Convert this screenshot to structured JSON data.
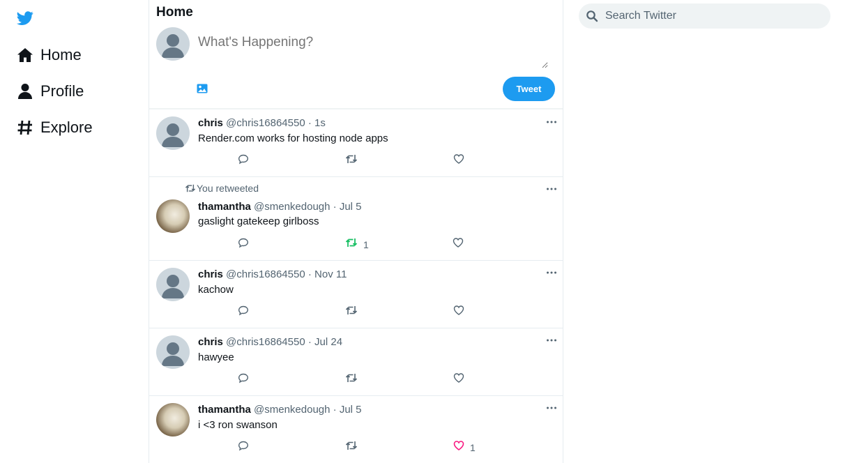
{
  "app": {
    "title": "Twitter",
    "brand_color": "#1d9bf0"
  },
  "sidebar": {
    "items": [
      {
        "label": "Home",
        "icon": "home-icon"
      },
      {
        "label": "Profile",
        "icon": "user-icon"
      },
      {
        "label": "Explore",
        "icon": "hashtag-icon"
      }
    ]
  },
  "main": {
    "title": "Home",
    "compose": {
      "placeholder": "What's Happening?",
      "tweet_button": "Tweet"
    }
  },
  "search": {
    "placeholder": "Search Twitter"
  },
  "tweets": [
    {
      "name": "chris",
      "handle": "@chris16864550",
      "time": "1s",
      "text": "Render.com works for hosting node apps",
      "retweet_count": "",
      "like_count": "",
      "retweeted_by_you": false,
      "liked": false,
      "avatar": "default-avatar"
    },
    {
      "name": "thamantha",
      "handle": "@smenkedough",
      "time": "Jul 5",
      "text": "gaslight gatekeep girlboss",
      "retweet_count": "1",
      "like_count": "",
      "retweeted_by_you": true,
      "retweet_label": "You retweeted",
      "liked": false,
      "avatar": "photo-avatar"
    },
    {
      "name": "chris",
      "handle": "@chris16864550",
      "time": "Nov 11",
      "text": "kachow",
      "retweet_count": "",
      "like_count": "",
      "retweeted_by_you": false,
      "liked": false,
      "avatar": "default-avatar"
    },
    {
      "name": "chris",
      "handle": "@chris16864550",
      "time": "Jul 24",
      "text": "hawyee",
      "retweet_count": "",
      "like_count": "",
      "retweeted_by_you": false,
      "liked": false,
      "avatar": "default-avatar"
    },
    {
      "name": "thamantha",
      "handle": "@smenkedough",
      "time": "Jul 5",
      "text": "i <3 ron swanson",
      "retweet_count": "",
      "like_count": "1",
      "retweeted_by_you": false,
      "liked": true,
      "avatar": "photo-avatar"
    }
  ],
  "colors": {
    "retweet_active": "#17bf63",
    "like_active": "#f91880",
    "text_secondary": "#536471"
  }
}
